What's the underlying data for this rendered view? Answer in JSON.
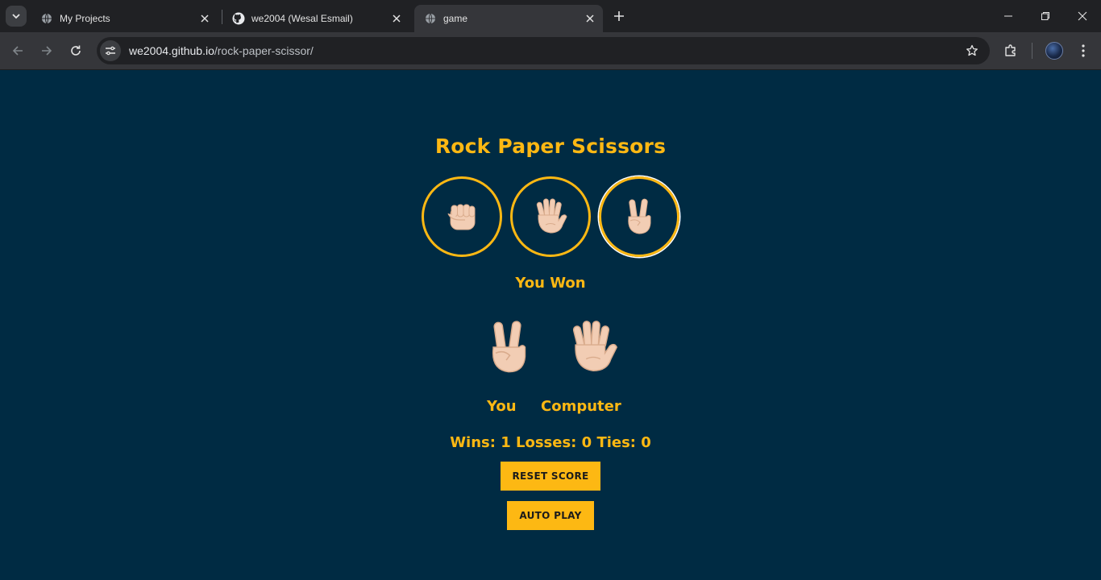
{
  "browser": {
    "tabs": [
      {
        "title": "My Projects",
        "favicon": "globe-icon",
        "active": false
      },
      {
        "title": "we2004 (Wesal Esmail)",
        "favicon": "github-icon",
        "active": false
      },
      {
        "title": "game",
        "favicon": "globe-icon",
        "active": true
      }
    ],
    "url_host": "we2004.github.io",
    "url_path": "/rock-paper-scissor/"
  },
  "game": {
    "title": "Rock Paper Scissors",
    "moves": [
      {
        "name": "rock",
        "icon": "fist-emoji-icon"
      },
      {
        "name": "paper",
        "icon": "open-hand-emoji-icon"
      },
      {
        "name": "scissors",
        "icon": "victory-hand-emoji-icon"
      }
    ],
    "result": "You Won",
    "player_label": "You",
    "computer_label": "Computer",
    "player_move_icon": "victory-hand-emoji-icon",
    "computer_move_icon": "open-hand-emoji-icon",
    "score": {
      "wins": 1,
      "losses": 0,
      "ties": 0
    },
    "score_text": "Wins: 1 Losses: 0 Ties: 0",
    "reset_label": "RESET SCORE",
    "autoplay_label": "AUTO PLAY"
  },
  "colors": {
    "background": "#002b43",
    "accent": "#fdb813",
    "skin": "#f2cdb4"
  }
}
